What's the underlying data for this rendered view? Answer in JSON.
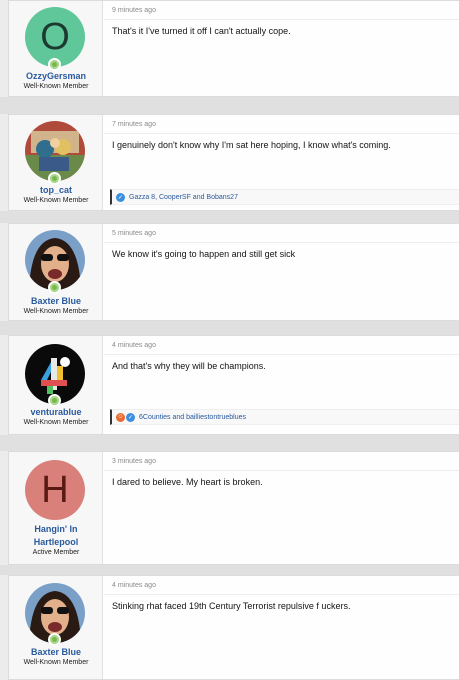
{
  "posts": [
    {
      "time": "9 minutes ago",
      "username": "OzzyGersman",
      "user_title": "Well-Known Member",
      "avatar_letter": "O",
      "avatar_color": "#5fc79a",
      "message": "That's it I've turned it off I can't actually cope."
    },
    {
      "time": "7 minutes ago",
      "username": "top_cat",
      "user_title": "Well-Known Member",
      "avatar_icon": "cartoon-cat-icon",
      "message": "I genuinely don't know why I'm sat here hoping, I know what's coming.",
      "reactions": "Gazza 8, CooperSF and Bobans27"
    },
    {
      "time": "5 minutes ago",
      "username": "Baxter Blue",
      "user_title": "Well-Known Member",
      "avatar_icon": "man-with-sunglasses-icon",
      "message": "We know it's going to happen and still get sick"
    },
    {
      "time": "4 minutes ago",
      "username": "venturablue",
      "user_title": "Well-Known Member",
      "avatar_icon": "channel-4-logo-icon",
      "message": "And that's why they will be champions.",
      "reactions": "6Counties and bailliestontrueblues"
    },
    {
      "time": "3 minutes ago",
      "username_line1": "Hangin' In",
      "username_line2": "Hartlepool",
      "user_title": "Active Member",
      "avatar_letter": "H",
      "avatar_color": "#d9807a",
      "message": "I dared to believe. My heart is broken."
    },
    {
      "time": "4 minutes ago",
      "username": "Baxter Blue",
      "user_title": "Well-Known Member",
      "avatar_icon": "man-with-sunglasses-icon",
      "message": "Stinking rhat faced 19th Century Terrorist repulsive f uckers."
    }
  ],
  "colors": {
    "link": "#2a5a9e",
    "online": "#7bb64f",
    "like": "#3d8ee0",
    "haha": "#e86a2c"
  }
}
